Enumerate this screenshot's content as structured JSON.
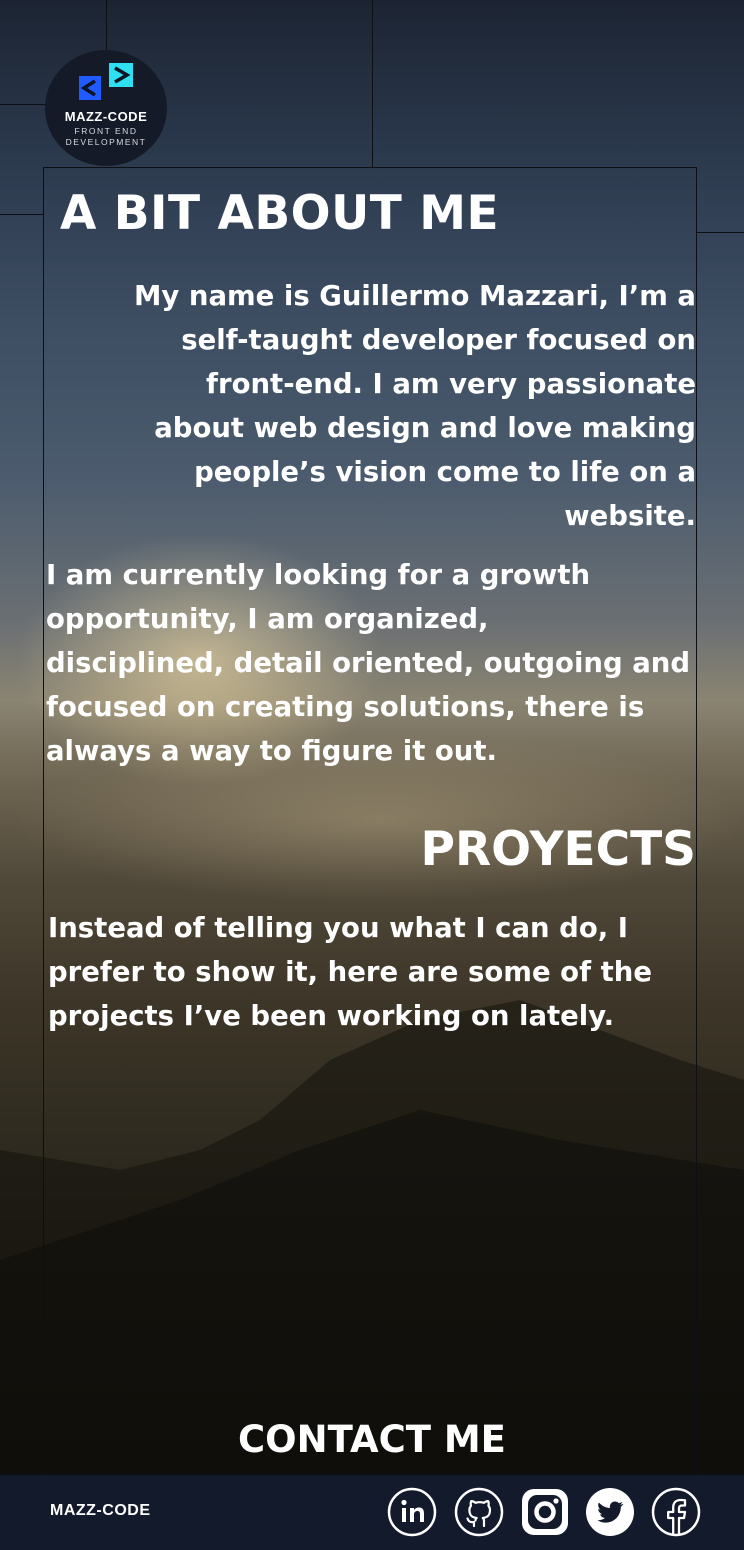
{
  "logo": {
    "name": "MAZZ-CODE",
    "sub_line1": "FRONT END",
    "sub_line2": "DEVELOPMENT",
    "icon": "code-brackets-logo-icon",
    "colors": {
      "blue": "#1f5bff",
      "cyan": "#2ee0f0"
    }
  },
  "about": {
    "title": "A BIT ABOUT ME",
    "paragraph1_lines": [
      "My name is Guillermo Mazzari, I’m a",
      "self-taught developer focused on",
      "front-end. I am very passionate",
      "about web design and love making",
      "people’s vision come to life on a",
      "website."
    ],
    "paragraph2_lines": [
      "I am currently looking for a growth",
      "opportunity, I am organized,",
      "disciplined, detail oriented, outgoing and",
      "focused on creating solutions, there is",
      "always a way to figure it out."
    ]
  },
  "projects": {
    "title": "PROYECTS",
    "text_lines": [
      "Instead of telling you what I can do, I",
      "prefer to show it, here are some of the",
      "projects I’ve been working on lately."
    ]
  },
  "contact": {
    "title": "CONTACT ME"
  },
  "footer": {
    "brand": "MAZZ-CODE",
    "background": "#131a2b",
    "socials": [
      "linkedin-icon",
      "github-icon",
      "instagram-icon",
      "twitter-icon",
      "facebook-icon"
    ]
  }
}
